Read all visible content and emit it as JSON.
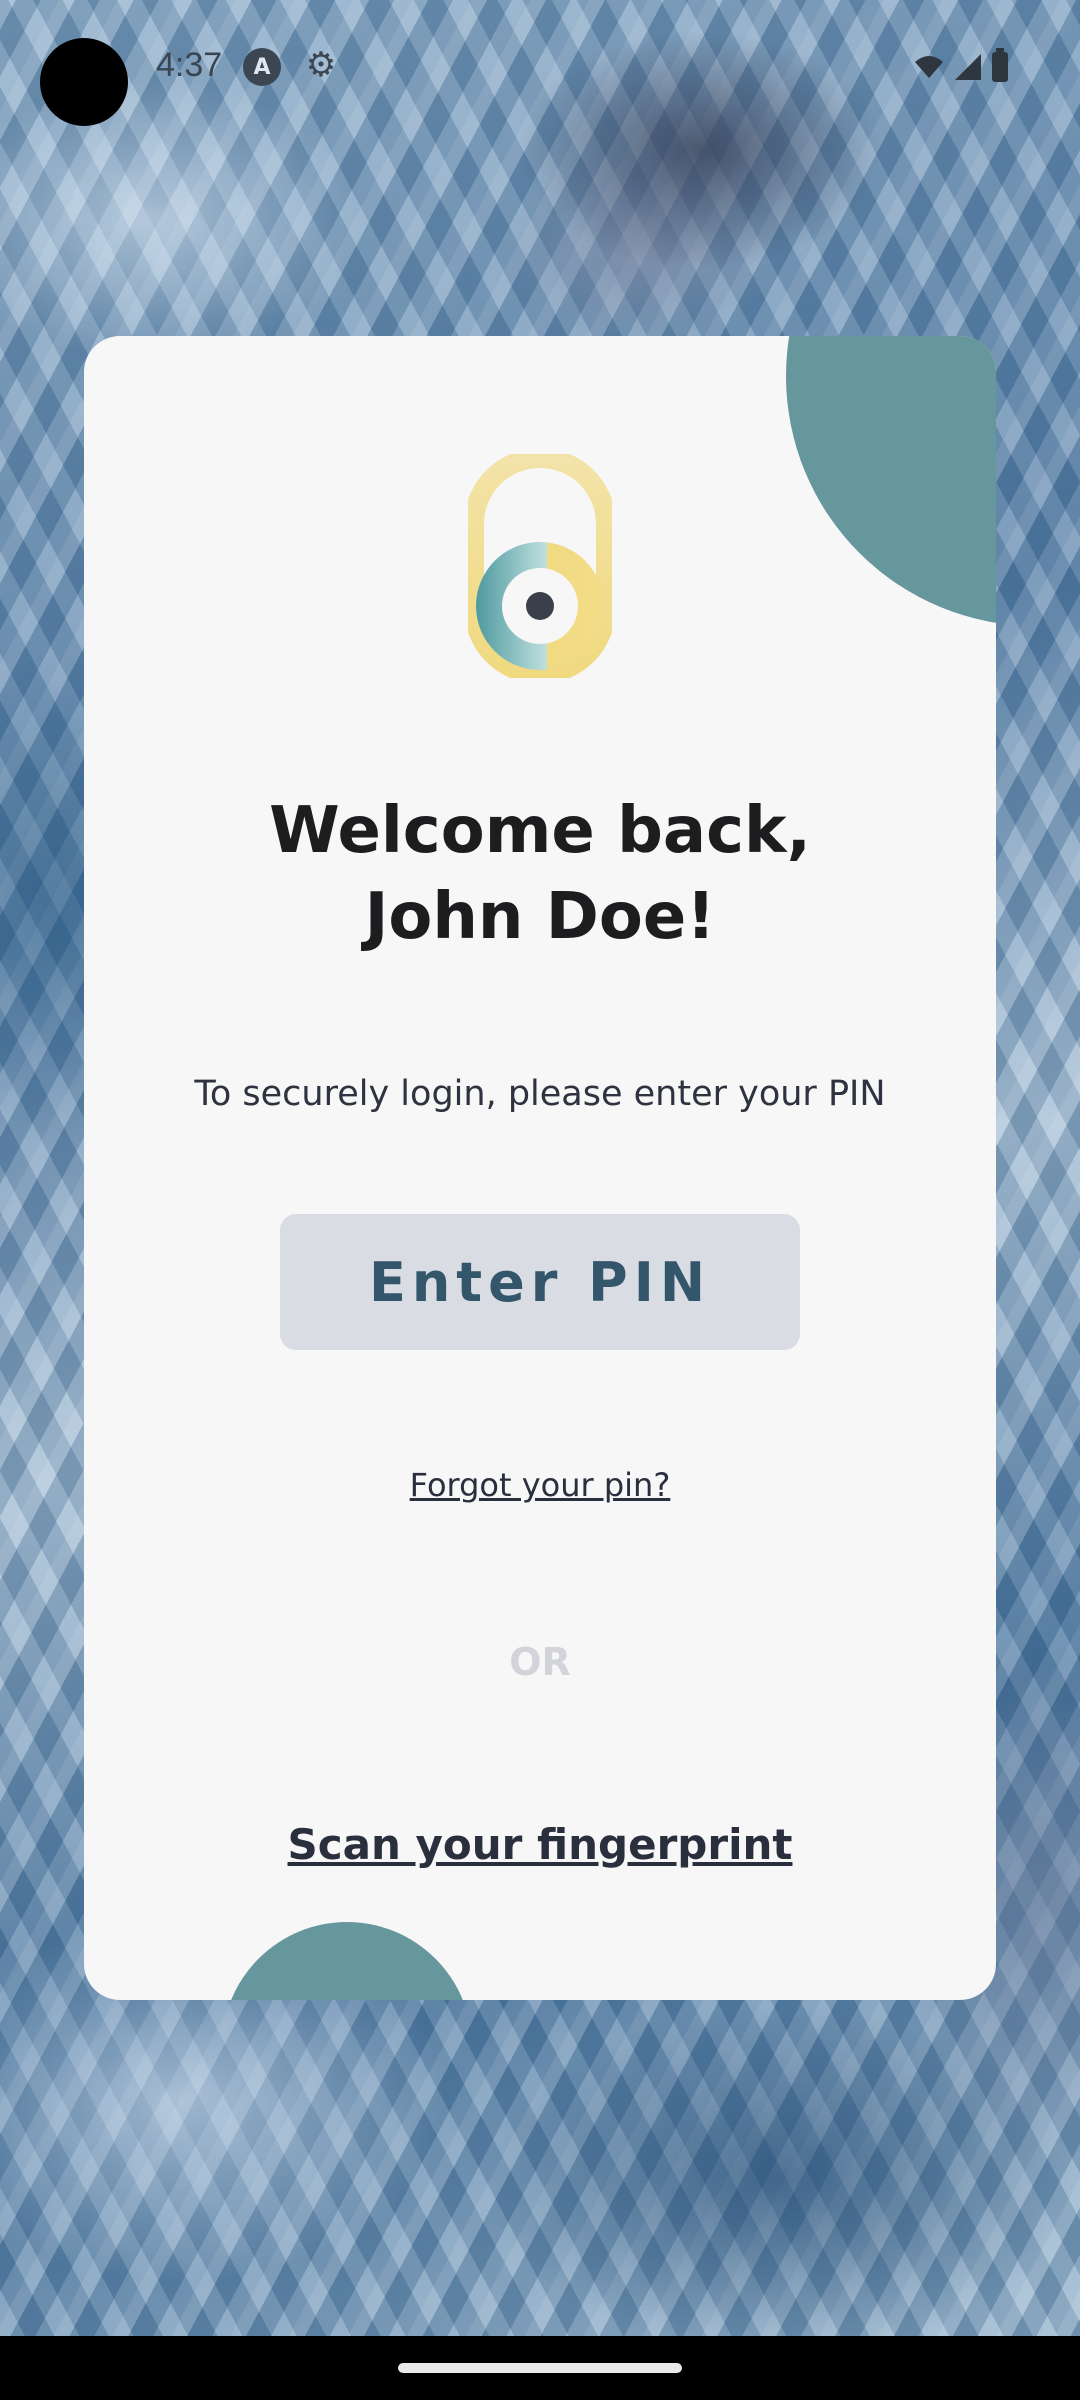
{
  "status_bar": {
    "time": "4:37",
    "icons": [
      "a-notification-icon",
      "gear-icon",
      "wifi-icon",
      "signal-icon",
      "battery-icon"
    ]
  },
  "card": {
    "title": "Welcome back, John Doe!",
    "subtitle": "To securely login, please enter your PIN",
    "enter_pin_label": "Enter PIN",
    "forgot_label": "Forgot your pin?",
    "or_label": "OR",
    "fingerprint_label": "Scan your fingerprint"
  },
  "colors": {
    "accent_teal": "#66979d",
    "card_bg": "#f7f7f8",
    "button_bg": "#dadce3",
    "button_text": "#33566a",
    "lock_yellow": "#f0dc8e"
  }
}
